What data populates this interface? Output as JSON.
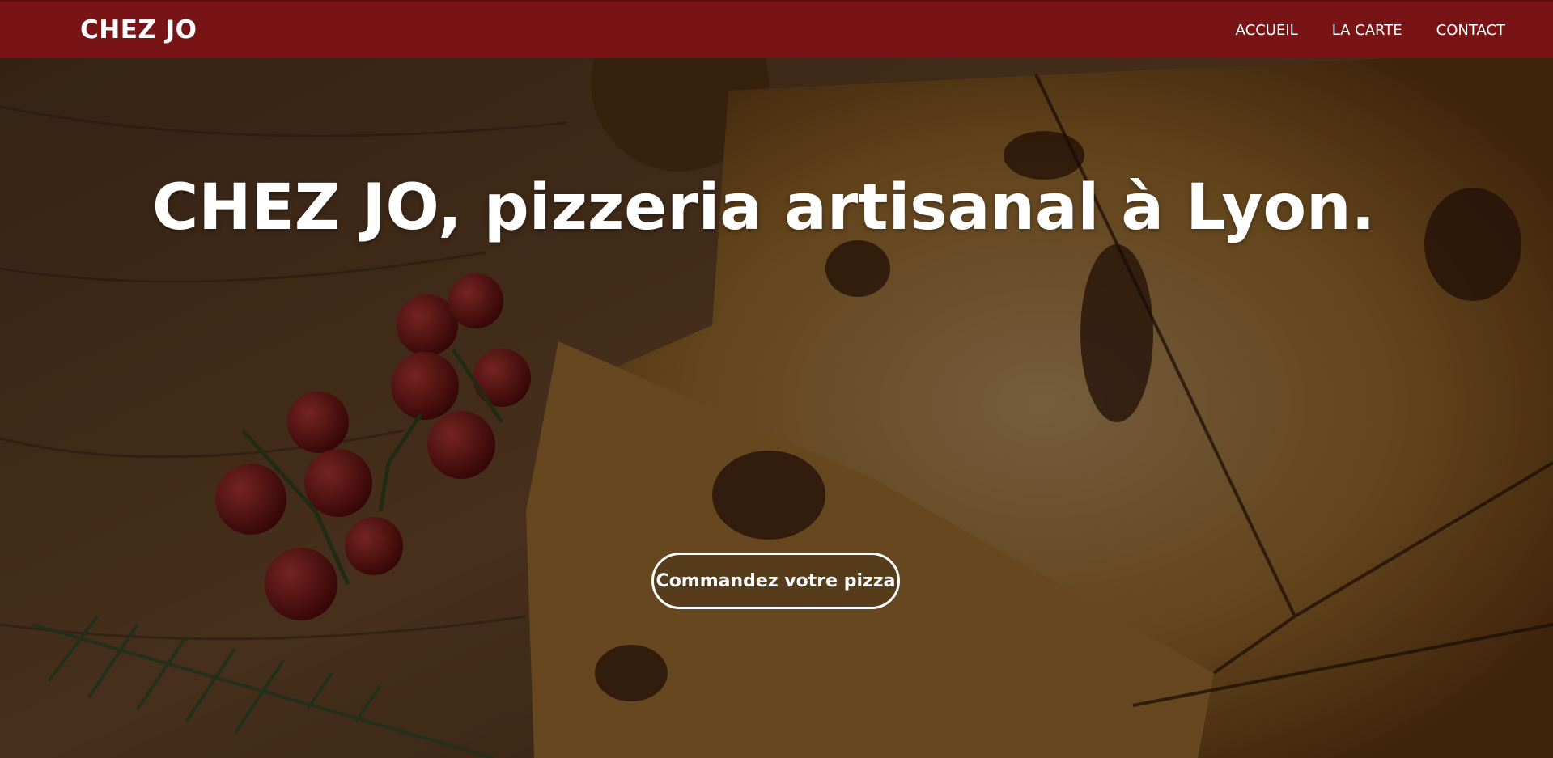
{
  "header": {
    "brand": "CHEZ JO",
    "nav": [
      {
        "label": "ACCUEIL"
      },
      {
        "label": "LA CARTE"
      },
      {
        "label": "CONTACT"
      }
    ]
  },
  "hero": {
    "title": "CHEZ JO, pizzeria artisanal à Lyon.",
    "cta_label": "Commandez votre pizza"
  },
  "colors": {
    "navbar": "#781416",
    "text": "#ffffff"
  }
}
